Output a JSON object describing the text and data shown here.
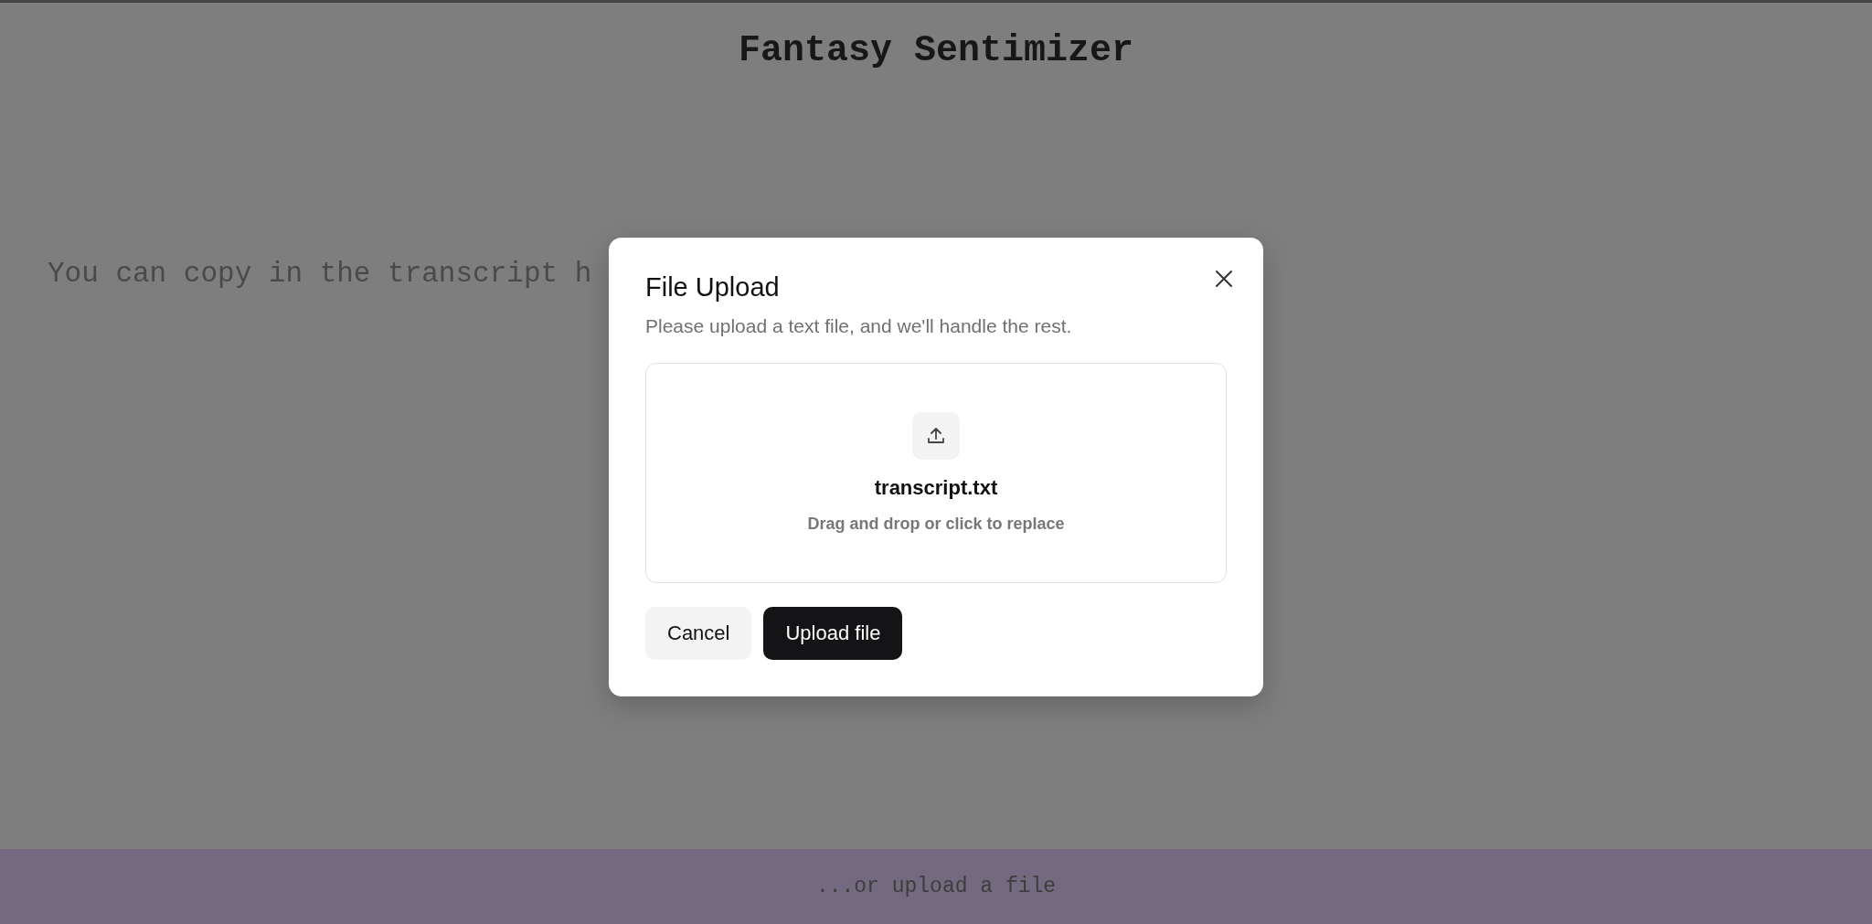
{
  "app": {
    "title": "Fantasy Sentimizer",
    "intro_text": "You can copy in the transcript h"
  },
  "dialog": {
    "title": "File Upload",
    "description": "Please upload a text file, and we'll handle the rest.",
    "dropzone": {
      "file_name": "transcript.txt",
      "hint": "Drag and drop or click to replace"
    },
    "buttons": [
      {
        "label": "Cancel",
        "kind": "secondary"
      },
      {
        "label": "Upload file",
        "kind": "primary"
      }
    ]
  },
  "footer": {
    "label": "...or upload a file"
  }
}
